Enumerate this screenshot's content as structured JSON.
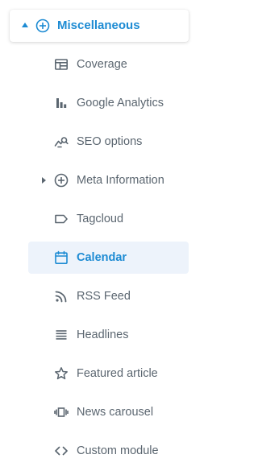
{
  "colors": {
    "accent": "#1d8bd3",
    "text": "#5b6670",
    "active_bg": "#edf3fb"
  },
  "section": {
    "title": "Miscellaneous",
    "icon": "plus-circle-icon",
    "expanded": true
  },
  "items": [
    {
      "label": "Coverage",
      "icon": "coverage-layout-icon"
    },
    {
      "label": "Google Analytics",
      "icon": "bar-chart-icon"
    },
    {
      "label": "SEO options",
      "icon": "seo-trend-magnifier-icon"
    },
    {
      "label": "Meta Information",
      "icon": "plus-circle-icon",
      "has_children": true
    },
    {
      "label": "Tagcloud",
      "icon": "tag-icon"
    },
    {
      "label": "Calendar",
      "icon": "calendar-icon",
      "active": true
    },
    {
      "label": "RSS Feed",
      "icon": "rss-icon"
    },
    {
      "label": "Headlines",
      "icon": "list-lines-icon"
    },
    {
      "label": "Featured article",
      "icon": "star-icon"
    },
    {
      "label": "News carousel",
      "icon": "carousel-icon"
    },
    {
      "label": "Custom module",
      "icon": "code-brackets-icon"
    }
  ]
}
